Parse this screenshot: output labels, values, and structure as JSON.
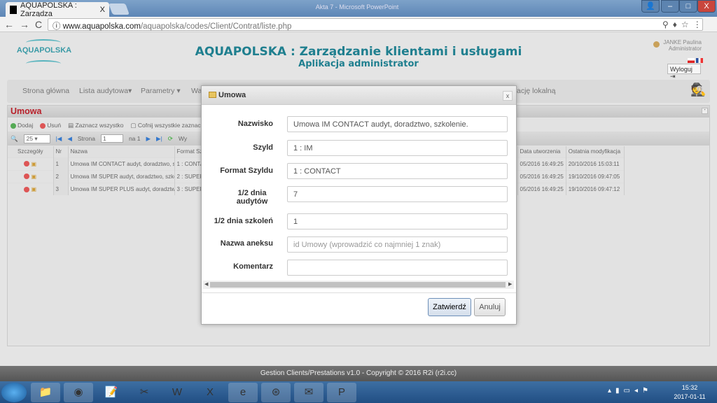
{
  "browser": {
    "tab_title": "AQUAPOLSKA : Zarządza",
    "tab_close": "X",
    "window_title": "Akta 7 - Microsoft PowerPoint",
    "url_host": "www.aquapolska.com",
    "url_path": "/aquapolska/codes/Client/Contrat/liste.php",
    "window_buttons": [
      "–",
      "□",
      "X"
    ]
  },
  "header": {
    "logo": "AQUAPOLSKA",
    "title": "AQUAPOLSKA : Zarządzanie klientami i usługami",
    "subtitle": "Aplikacja administrator",
    "user_name": "JANKE Paulina",
    "user_role": "Administrator",
    "logout": "Wyloguj"
  },
  "menu": [
    "Strona główna",
    "Lista audytowa▾",
    "Parametry ▾",
    "Wa",
    "ację lokalną"
  ],
  "panel": {
    "title": "Umowa",
    "toolbar": {
      "add": "Dodaj",
      "delete": "Usuń",
      "select_all": "Zaznacz wszystko",
      "deselect_all": "Cofnij wszystkie zaznaczen",
      "page_size": "25",
      "page_label": "Strona",
      "page": "1",
      "page_of": "na 1",
      "view": "Wy"
    },
    "columns": [
      "Szczegóły",
      "Nr",
      "Nazwa",
      "Format Szy",
      "Data utworzenia",
      "Ostatnia modyfikacja"
    ],
    "rows": [
      {
        "nr": "1",
        "name": "Umowa IM CONTACT audyt, doradztwo, sz",
        "format": "1 : CONTA",
        "created": "05/2016 16:49:25",
        "modified": "20/10/2016 15:03:11"
      },
      {
        "nr": "2",
        "name": "Umowa IM SUPER audyt, doradztwo, szko",
        "format": "2 : SUPER",
        "created": "05/2016 16:49:25",
        "modified": "19/10/2016 09:47:05"
      },
      {
        "nr": "3",
        "name": "Umowa IM SUPER PLUS audyt, doradztwc",
        "format": "3 : SUPER",
        "created": "05/2016 16:49:25",
        "modified": "19/10/2016 09:47:12"
      }
    ]
  },
  "modal": {
    "title": "Umowa",
    "close": "x",
    "fields": [
      {
        "label": "Nazwisko",
        "value": "Umowa IM CONTACT audyt, doradztwo, szkolenie.",
        "placeholder": ""
      },
      {
        "label": "Szyld",
        "value": "1 : IM",
        "placeholder": ""
      },
      {
        "label": "Format Szyldu",
        "value": "1 : CONTACT",
        "placeholder": ""
      },
      {
        "label": "1/2 dnia audytów",
        "value": "7",
        "placeholder": ""
      },
      {
        "label": "1/2 dnia szkoleń",
        "value": "1",
        "placeholder": ""
      },
      {
        "label": "Nazwa aneksu",
        "value": "",
        "placeholder": "id Umowy (wprowadzić co najmniej 1 znak)"
      },
      {
        "label": "Komentarz",
        "value": "",
        "placeholder": ""
      }
    ],
    "confirm": "Zatwierdź",
    "cancel": "Anuluj"
  },
  "footer": "Gestion Clients/Prestations v1.0 - Copyright © 2016 R2i (r2i.cc)",
  "taskbar": {
    "time": "15:32",
    "date": "2017-01-11"
  },
  "colors": {
    "accent": "#1f7f8f",
    "panel_title": "#b8202a",
    "taskbar": "#2a5a90"
  }
}
